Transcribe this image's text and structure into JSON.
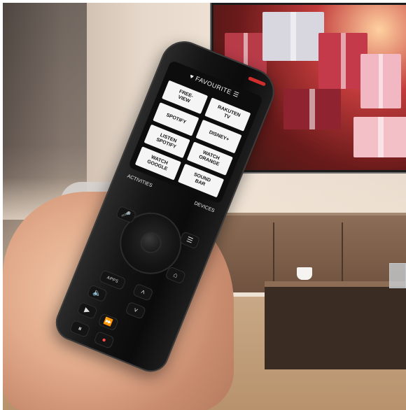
{
  "remote": {
    "screen": {
      "header": "♥ FAVOURITE ☰",
      "tiles": [
        {
          "label": "FREE-\nVIEW"
        },
        {
          "label": "RAKUTEN\nTV"
        },
        {
          "label": "SPOTIFY"
        },
        {
          "label": "DISNEY+"
        },
        {
          "label": "LISTEN\nSPOTIFY"
        },
        {
          "label": "WATCH\nORANGE"
        },
        {
          "label": "WATCH\nGOOGLE"
        },
        {
          "label": "SOUND\nBAR"
        }
      ]
    },
    "tabs": {
      "activities": "ACTIVITIES",
      "devices": "DEVICES"
    },
    "buttons": {
      "apps": "APPS"
    }
  },
  "colors": {
    "led": "#d22d2d",
    "tile_bg": "#f5f5f5",
    "remote_body": "#0b0b0b"
  }
}
